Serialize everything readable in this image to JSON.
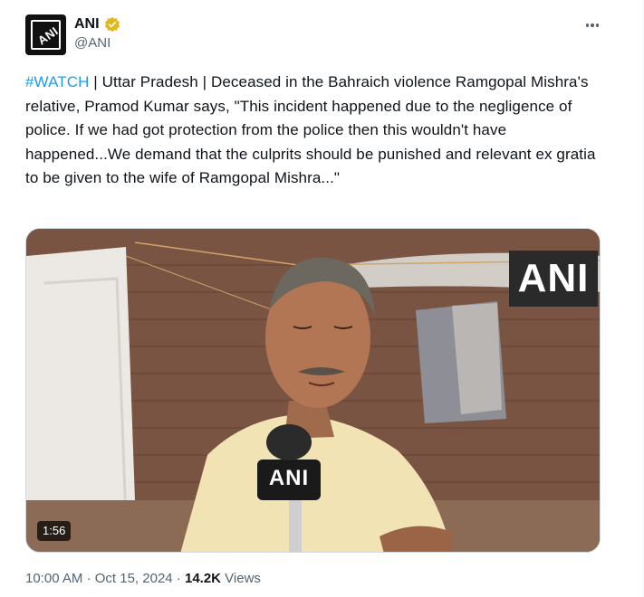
{
  "author": {
    "name": "ANI",
    "handle": "@ANI",
    "avatar_text": "ANI",
    "verified_color": "#e2b719"
  },
  "tweet": {
    "hashtag": "#WATCH",
    "body": " | Uttar Pradesh | Deceased in the Bahraich violence Ramgopal Mishra's relative, Pramod Kumar says, \"This incident happened due to the negligence of police. If we had got protection from the police then this wouldn't have happened...We demand that the culprits should be punished and relevant ex gratia to be given to the wife of Ramgopal Mishra...\""
  },
  "media": {
    "watermark": "ANI",
    "mic_label": "ANI",
    "duration": "1:56"
  },
  "meta": {
    "time": "10:00 AM",
    "separator": " · ",
    "date": "Oct 15, 2024",
    "separator2": " · ",
    "views_count": "14.2K",
    "views_label": " Views"
  },
  "colors": {
    "link": "#1d9bf0",
    "secondary_text": "#536471"
  },
  "icons": {
    "verified": "verified-badge-icon",
    "more": "more-options-icon"
  }
}
